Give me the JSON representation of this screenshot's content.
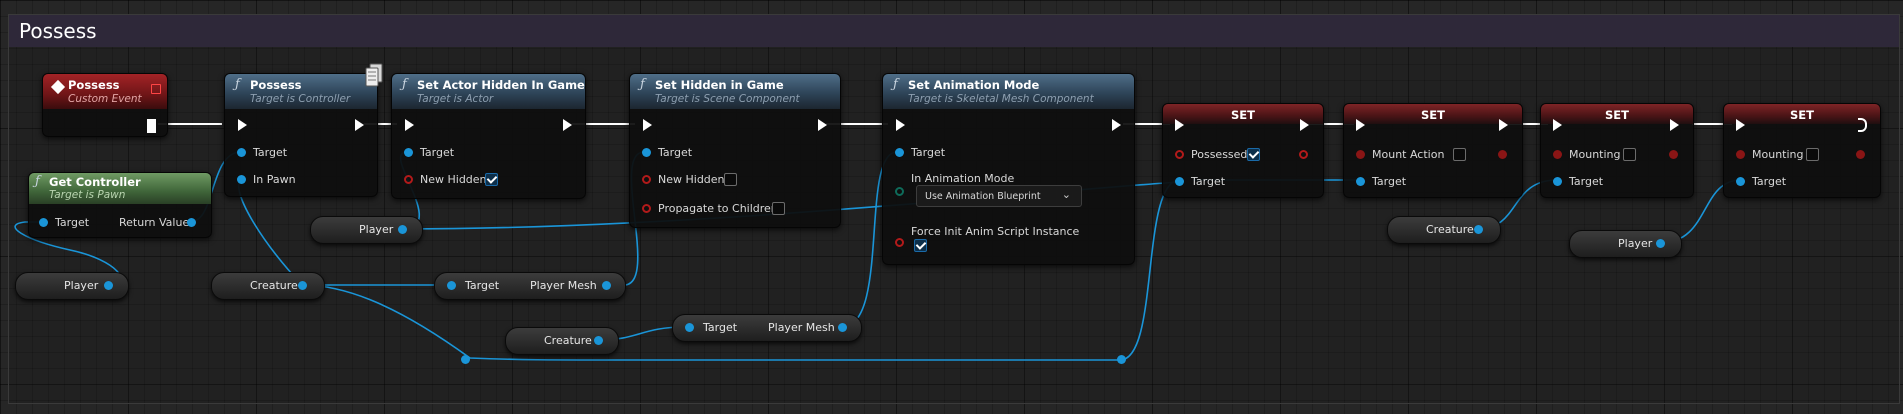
{
  "graph": {
    "comment_title": "Possess"
  },
  "nodes": {
    "possess_event": {
      "title": "Possess",
      "subtitle": "Custom Event"
    },
    "possess_func": {
      "title": "Possess",
      "subtitle": "Target is Controller",
      "pin_target": "Target",
      "pin_in_pawn": "In Pawn"
    },
    "set_actor_hidden": {
      "title": "Set Actor Hidden In Game",
      "subtitle": "Target is Actor",
      "pin_target": "Target",
      "pin_new_hidden": "New Hidden",
      "new_hidden_checked": true
    },
    "set_hidden_in_game": {
      "title": "Set Hidden in Game",
      "subtitle": "Target is Scene Component",
      "pin_target": "Target",
      "pin_new_hidden": "New Hidden",
      "pin_propagate": "Propagate to Children",
      "new_hidden_checked": false,
      "propagate_checked": false
    },
    "set_animation_mode": {
      "title": "Set Animation Mode",
      "subtitle": "Target is Skeletal Mesh Component",
      "pin_target": "Target",
      "pin_in_mode": "In Animation Mode",
      "mode_value": "Use Animation Blueprint",
      "pin_force_init": "Force Init Anim Script Instance",
      "force_init_checked": true
    },
    "get_controller": {
      "title": "Get Controller",
      "subtitle": "Target is Pawn",
      "pin_target": "Target",
      "pin_return": "Return Value"
    },
    "set1": {
      "title": "SET",
      "var": "Possessed",
      "checked": true,
      "pin_target": "Target"
    },
    "set2": {
      "title": "SET",
      "var": "Mount Action",
      "checked": false,
      "pin_target": "Target"
    },
    "set3": {
      "title": "SET",
      "var": "Mounting",
      "checked": false,
      "pin_target": "Target"
    },
    "set4": {
      "title": "SET",
      "var": "Mounting",
      "checked": false,
      "pin_target": "Target"
    }
  },
  "variables": {
    "player_a": "Player",
    "player_b": "Player",
    "player_c": "Player",
    "creature_a": "Creature",
    "creature_b": "Creature",
    "creature_c": "Creature"
  },
  "getters": {
    "mesh_a": {
      "target": "Target",
      "value": "Player Mesh"
    },
    "mesh_b": {
      "target": "Target",
      "value": "Player Mesh"
    }
  },
  "colors": {
    "object_wire": "#1a95d8",
    "exec_wire": "#ffffff",
    "bool_pin": "#b21a1a",
    "comment_header": "#2e2839"
  }
}
